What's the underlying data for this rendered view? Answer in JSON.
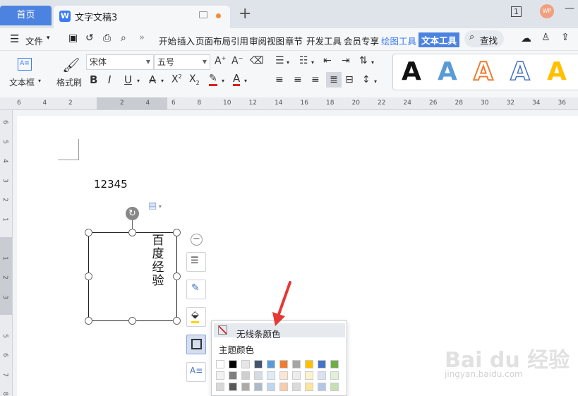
{
  "tabs": {
    "home": "首页",
    "doc": "文字文稿3",
    "doc_icon": "W"
  },
  "titlebar": {
    "window_count": "1",
    "avatar_text": "WP"
  },
  "menu": {
    "file": "文件",
    "items": [
      "开始",
      "插入",
      "页面布局",
      "引用",
      "审阅",
      "视图",
      "章节",
      "开发工具",
      "会员专享",
      "绘图工具"
    ],
    "active": "文本工具",
    "search": "查找"
  },
  "ribbon": {
    "textbox_label": "文本框",
    "format_painter_label": "格式刷",
    "font_name": "宋体",
    "font_size": "五号",
    "styles_count": 5
  },
  "ruler": {
    "h_ticks": [
      "6",
      "4",
      "2",
      "",
      "2",
      "4",
      "6",
      "8",
      "10",
      "12",
      "14",
      "16",
      "18",
      "20",
      "22",
      "24",
      "26",
      "28",
      "30",
      "32",
      "34",
      "36"
    ],
    "v_ticks": [
      "6",
      "5",
      "4",
      "3",
      "2",
      "1",
      "",
      "1",
      "2",
      "3",
      "",
      "5",
      "6",
      "7",
      "8"
    ]
  },
  "document": {
    "body_text": "12345",
    "textbox_chars": [
      "百",
      "度",
      "经",
      "验"
    ]
  },
  "dropdown": {
    "no_line_color": "无线条颜色",
    "theme_colors": "主题颜色",
    "swatch_row": [
      "#ffffff",
      "#000000",
      "#e7e6e6",
      "#44546a",
      "#5b9bd5",
      "#ed7d31",
      "#a5a5a5",
      "#ffc000",
      "#4472c4",
      "#70ad47"
    ],
    "swatch_row2": [
      "#f2f2f2",
      "#7f7f7f",
      "#d0cece",
      "#d6dce4",
      "#deebf6",
      "#fbe5d5",
      "#ededed",
      "#fff2cc",
      "#d9e2f3",
      "#e2efd9"
    ],
    "swatch_row3": [
      "#d8d8d8",
      "#595959",
      "#aeaaaa",
      "#adb9ca",
      "#bdd7ee",
      "#f7cbac",
      "#dbdbdb",
      "#ffe599",
      "#b4c6e7",
      "#c5e0b3"
    ]
  },
  "watermark": {
    "main": "Bai du 经验",
    "sub": "jingyan.baidu.com"
  },
  "colors": {
    "accent": "#4d83e0",
    "wps_orange": "#f08c3c",
    "arrow_red": "#e53935"
  }
}
